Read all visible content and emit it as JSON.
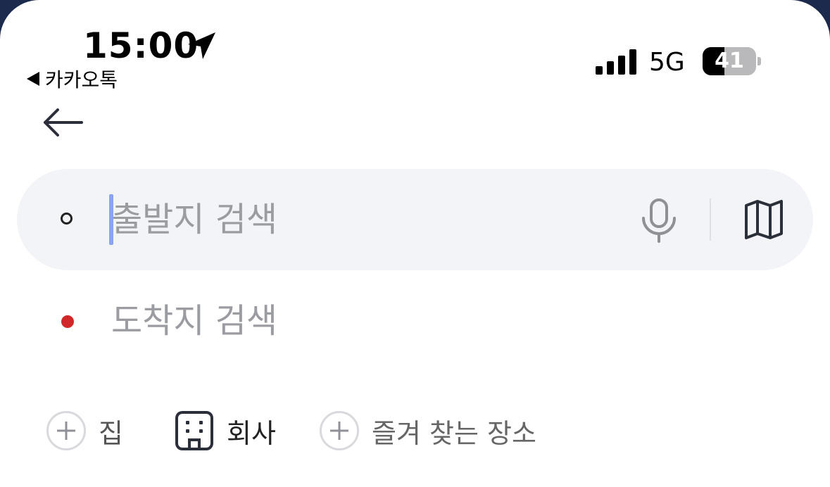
{
  "status_bar": {
    "time": "15:00",
    "back_app": "카카오톡",
    "network": "5G",
    "battery_level": "41",
    "battery_percent": 41,
    "location_icon": "location-arrow-icon",
    "signal_icon": "cellular-signal-icon"
  },
  "nav": {
    "back_icon": "arrow-left-icon"
  },
  "search": {
    "origin_placeholder": "출발지 검색",
    "origin_value": "",
    "destination_placeholder": "도착지 검색",
    "destination_value": "",
    "mic_icon": "microphone-icon",
    "map_icon": "map-icon"
  },
  "quick_places": [
    {
      "label": "집",
      "icon": "plus-circle-icon"
    },
    {
      "label": "회사",
      "icon": "building-icon"
    },
    {
      "label": "즐겨 찾는 장소",
      "icon": "plus-circle-icon"
    }
  ],
  "colors": {
    "search_bg": "#f3f4f7",
    "destination_dot": "#d0282a",
    "caret": "#8aa4f0",
    "placeholder": "#9a9ca1"
  }
}
